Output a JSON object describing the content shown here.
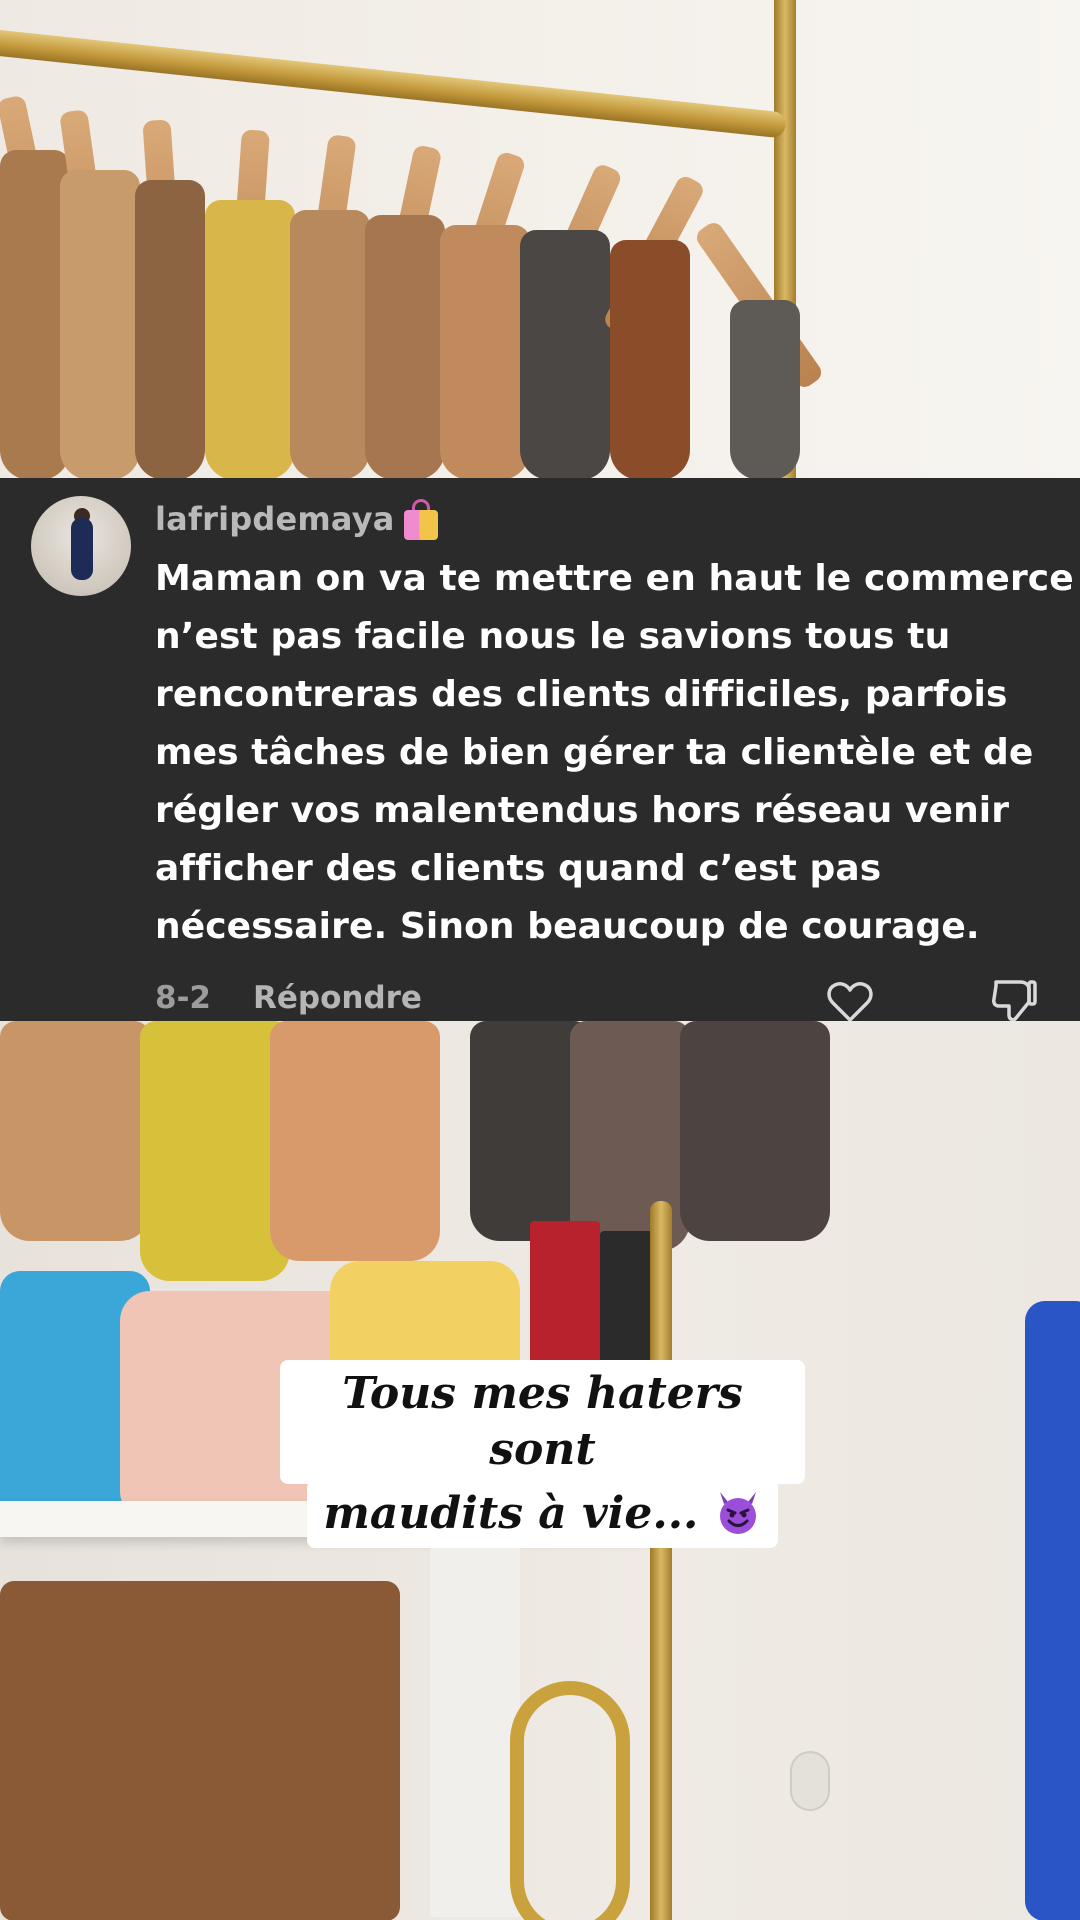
{
  "comment": {
    "username": "lafripdemaya",
    "username_emoji": "shopping-bags-icon",
    "text_lines": [
      "Maman on va te mettre en haut le commerce",
      "n’est pas facile nous le savions tous tu",
      "rencontreras des clients difficiles, parfois",
      "mes tâches de bien gérer ta clientèle et de",
      "régler vos malentendus hors réseau venir",
      "afficher des clients quand c’est pas",
      "nécessaire. Sinon beaucoup de courage."
    ],
    "date": "8-2",
    "reply_label": "Répondre",
    "like_icon": "heart-icon",
    "dislike_icon": "thumbs-down-icon"
  },
  "caption": {
    "line1": "Tous mes haters sont",
    "line2": "maudits à vie...",
    "emoji": "smiling-devil-icon"
  },
  "colors": {
    "comment_bg": "#2b2b2b",
    "text_primary": "#ffffff",
    "text_secondary": "#b9b9b9",
    "caption_bg": "#ffffff",
    "caption_text": "#111111"
  }
}
